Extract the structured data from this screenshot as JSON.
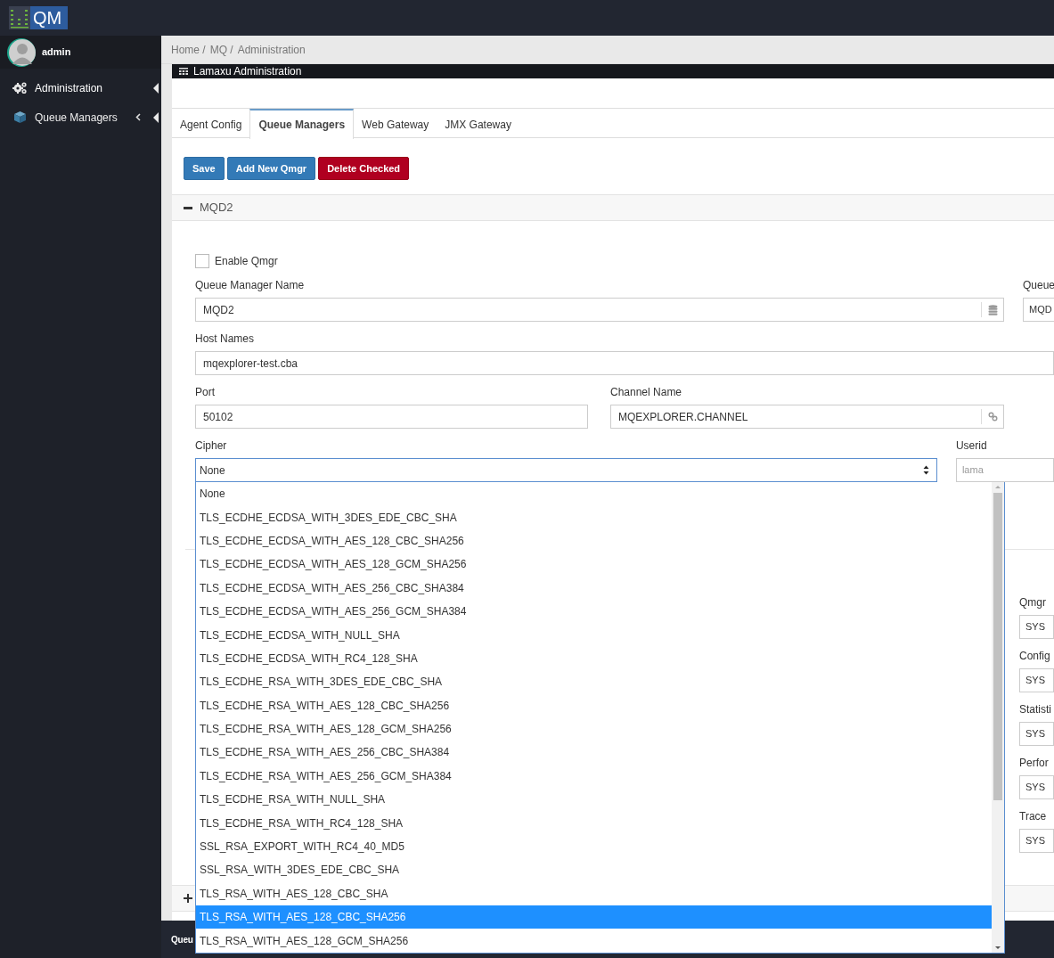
{
  "logo": {
    "text": "QM"
  },
  "user": {
    "name": "admin"
  },
  "sidebar": {
    "items": [
      {
        "label": "Administration",
        "selected": true,
        "has_chevron": false
      },
      {
        "label": "Queue Managers",
        "selected": false,
        "has_chevron": true
      }
    ]
  },
  "breadcrumb": [
    "Home /",
    "MQ /",
    "Administration"
  ],
  "panel": {
    "title": "Lamaxu Administration"
  },
  "tabs": [
    {
      "label": "Agent Config",
      "selected": false
    },
    {
      "label": "Queue Managers",
      "selected": true
    },
    {
      "label": "Web Gateway",
      "selected": false
    },
    {
      "label": "JMX Gateway",
      "selected": false
    }
  ],
  "buttons": [
    {
      "label": "Save",
      "kind": "primary"
    },
    {
      "label": "Add New Qmgr",
      "kind": "primary"
    },
    {
      "label": "Delete Checked",
      "kind": "danger"
    }
  ],
  "section": {
    "title": "MQD2",
    "expanded": true
  },
  "form": {
    "enable": {
      "label": "Enable Qmgr",
      "checked": false
    },
    "qmgr_name": {
      "label": "Queue Manager Name",
      "value": "MQD2"
    },
    "host_names": {
      "label": "Host Names",
      "value": "mqexplorer-test.cba"
    },
    "port": {
      "label": "Port",
      "value": "50102"
    },
    "channel": {
      "label": "Channel Name",
      "value": "MQEXPLORER.CHANNEL"
    },
    "cipher": {
      "label": "Cipher",
      "value": "None"
    },
    "right_column": [
      {
        "label": "Queue",
        "value": "MQD"
      },
      {
        "label": "Userid",
        "placeholder": "lama"
      },
      {
        "label": "Qmgr",
        "value": "SYS"
      },
      {
        "label": "Config",
        "value": "SYS"
      },
      {
        "label": "Statisti",
        "value": "SYS"
      },
      {
        "label": "Perfor",
        "value": "SYS"
      },
      {
        "label": "Trace",
        "value": "SYS"
      }
    ]
  },
  "cipher_options": [
    {
      "label": "None",
      "selected": false
    },
    {
      "label": "TLS_ECDHE_ECDSA_WITH_3DES_EDE_CBC_SHA",
      "selected": false
    },
    {
      "label": "TLS_ECDHE_ECDSA_WITH_AES_128_CBC_SHA256",
      "selected": false
    },
    {
      "label": "TLS_ECDHE_ECDSA_WITH_AES_128_GCM_SHA256",
      "selected": false
    },
    {
      "label": "TLS_ECDHE_ECDSA_WITH_AES_256_CBC_SHA384",
      "selected": false
    },
    {
      "label": "TLS_ECDHE_ECDSA_WITH_AES_256_GCM_SHA384",
      "selected": false
    },
    {
      "label": "TLS_ECDHE_ECDSA_WITH_NULL_SHA",
      "selected": false
    },
    {
      "label": "TLS_ECDHE_ECDSA_WITH_RC4_128_SHA",
      "selected": false
    },
    {
      "label": "TLS_ECDHE_RSA_WITH_3DES_EDE_CBC_SHA",
      "selected": false
    },
    {
      "label": "TLS_ECDHE_RSA_WITH_AES_128_CBC_SHA256",
      "selected": false
    },
    {
      "label": "TLS_ECDHE_RSA_WITH_AES_128_GCM_SHA256",
      "selected": false
    },
    {
      "label": "TLS_ECDHE_RSA_WITH_AES_256_CBC_SHA384",
      "selected": false
    },
    {
      "label": "TLS_ECDHE_RSA_WITH_AES_256_GCM_SHA384",
      "selected": false
    },
    {
      "label": "TLS_ECDHE_RSA_WITH_NULL_SHA",
      "selected": false
    },
    {
      "label": "TLS_ECDHE_RSA_WITH_RC4_128_SHA",
      "selected": false
    },
    {
      "label": "SSL_RSA_EXPORT_WITH_RC4_40_MD5",
      "selected": false
    },
    {
      "label": "SSL_RSA_WITH_3DES_EDE_CBC_SHA",
      "selected": false
    },
    {
      "label": "TLS_RSA_WITH_AES_128_CBC_SHA",
      "selected": false
    },
    {
      "label": "TLS_RSA_WITH_AES_128_CBC_SHA256",
      "selected": true
    },
    {
      "label": "TLS_RSA_WITH_AES_128_GCM_SHA256",
      "selected": false
    }
  ],
  "collapsed_section": {
    "expanded": false
  },
  "footer": {
    "text": "Queu"
  }
}
